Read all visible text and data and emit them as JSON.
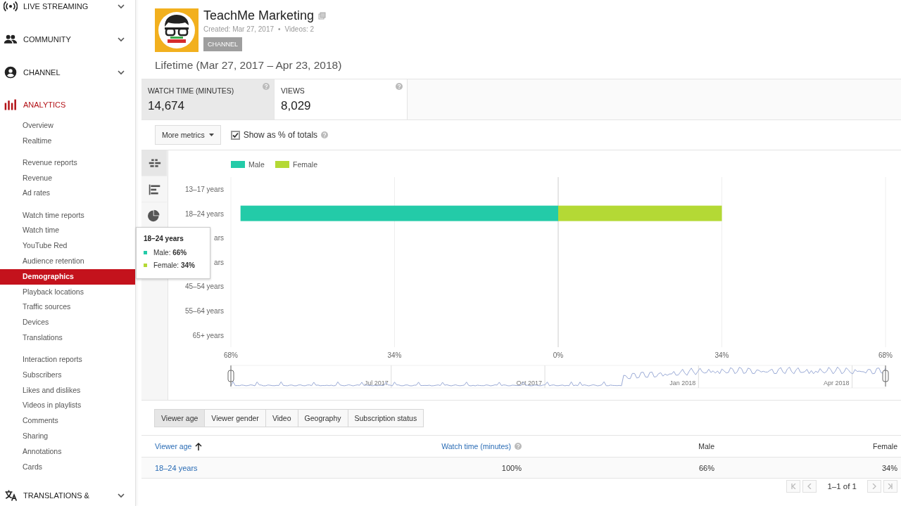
{
  "sidebar": {
    "sections": [
      {
        "label": "LIVE STREAMING",
        "selected": false
      },
      {
        "label": "COMMUNITY",
        "selected": false
      },
      {
        "label": "CHANNEL",
        "selected": false
      },
      {
        "label": "ANALYTICS",
        "selected": true,
        "groups": [
          [
            {
              "label": "Overview",
              "selected": false
            },
            {
              "label": "Realtime",
              "selected": false
            }
          ],
          [
            {
              "label": "Revenue reports",
              "selected": false
            },
            {
              "label": "Revenue",
              "selected": false
            },
            {
              "label": "Ad rates",
              "selected": false
            }
          ],
          [
            {
              "label": "Watch time reports",
              "selected": false
            },
            {
              "label": "Watch time",
              "selected": false
            },
            {
              "label": "YouTube Red",
              "selected": false
            },
            {
              "label": "Audience retention",
              "selected": false
            },
            {
              "label": "Demographics",
              "selected": true
            },
            {
              "label": "Playback locations",
              "selected": false
            },
            {
              "label": "Traffic sources",
              "selected": false
            },
            {
              "label": "Devices",
              "selected": false
            },
            {
              "label": "Translations",
              "selected": false
            }
          ],
          [
            {
              "label": "Interaction reports",
              "selected": false
            },
            {
              "label": "Subscribers",
              "selected": false
            },
            {
              "label": "Likes and dislikes",
              "selected": false
            },
            {
              "label": "Videos in playlists",
              "selected": false
            },
            {
              "label": "Comments",
              "selected": false
            },
            {
              "label": "Sharing",
              "selected": false
            },
            {
              "label": "Annotations",
              "selected": false
            },
            {
              "label": "Cards",
              "selected": false
            }
          ]
        ]
      },
      {
        "label": "TRANSLATIONS &",
        "selected": false
      }
    ]
  },
  "channel": {
    "name": "TeachMe Marketing",
    "created": "Created: Mar 27, 2017",
    "separator": "•",
    "videos": "Videos: 2",
    "badge": "CHANNEL",
    "range": "Lifetime (Mar 27, 2017 – Apr 23, 2018)"
  },
  "metrics": [
    {
      "label": "WATCH TIME (MINUTES)",
      "value": "14,674",
      "selected": true
    },
    {
      "label": "VIEWS",
      "value": "8,029",
      "selected": false
    }
  ],
  "controls": {
    "more_metrics": "More metrics",
    "show_percent": {
      "label": "Show as % of totals",
      "checked": true
    }
  },
  "chart_views": [
    {
      "selected": true
    },
    {
      "selected": false
    },
    {
      "selected": false
    }
  ],
  "chart": {
    "chart_data": {
      "type": "bar",
      "orientation": "horizontal",
      "stacked": true,
      "legend": "top",
      "categories": [
        "13–17 years",
        "18–24 years",
        "ars",
        "ars",
        "45–54 years",
        "55–64 years",
        "65+ years"
      ],
      "series": [
        {
          "name": "Male",
          "color": "#23cba8",
          "values": [
            0,
            -66,
            0,
            0,
            0,
            0,
            0
          ]
        },
        {
          "name": "Female",
          "color": "#b4d935",
          "values": [
            0,
            34,
            0,
            0,
            0,
            0,
            0
          ]
        }
      ],
      "xlim": [
        -68,
        68
      ],
      "xticks": [
        {
          "value": -68,
          "label": "68%"
        },
        {
          "value": -34,
          "label": "34%"
        },
        {
          "value": 0,
          "label": "0%"
        },
        {
          "value": 34,
          "label": "34%"
        },
        {
          "value": 68,
          "label": "68%"
        }
      ]
    },
    "tooltip": {
      "title": "18–24 years",
      "items": [
        {
          "text": "Male: **66%**",
          "color": "#23cba8"
        },
        {
          "text": "Female: **34%**",
          "color": "#b4d935"
        }
      ]
    },
    "timeline": {
      "labels": [
        "Jul 2017",
        "Oct 2017",
        "Jan 2018",
        "Apr 2018"
      ]
    }
  },
  "tabs": [
    {
      "label": "Viewer age",
      "selected": true
    },
    {
      "label": "Viewer gender",
      "selected": false
    },
    {
      "label": "Video",
      "selected": false
    },
    {
      "label": "Geography",
      "selected": false
    },
    {
      "label": "Subscription status",
      "selected": false
    }
  ],
  "table": {
    "columns": [
      {
        "label": "Viewer age",
        "sorted": true
      },
      {
        "label": "Watch time (minutes)",
        "sorted": false
      },
      {
        "label": "Male",
        "sorted": false
      },
      {
        "label": "Female",
        "sorted": false
      }
    ],
    "rows": [
      [
        "18–24 years",
        "100%",
        "66%",
        "34%"
      ]
    ],
    "pagination": "1–1 of 1"
  }
}
